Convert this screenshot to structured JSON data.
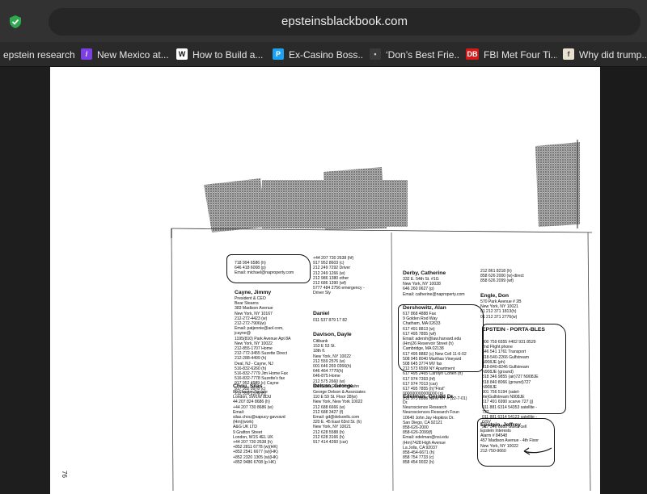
{
  "browser": {
    "url": "epsteinsblackbook.com",
    "bookmarks": [
      {
        "label": "epstein research",
        "icon": "folder-icon",
        "color": "#2a2a2a"
      },
      {
        "label": "New Mexico at...",
        "icon": "bookmark-icon",
        "color": "#7b3fe4"
      },
      {
        "label": "How to Build a...",
        "icon": "bookmark-icon",
        "color": "#111111"
      },
      {
        "label": "Ex-Casino Boss...",
        "icon": "bookmark-icon",
        "color": "#1da1f2"
      },
      {
        "label": "‘Don’s Best Frie...",
        "icon": "bookmark-icon",
        "color": "#333333"
      },
      {
        "label": "FBI Met Four Ti...",
        "icon": "bookmark-icon",
        "color": "#d11a1a"
      },
      {
        "label": "Why did trump...",
        "icon": "bookmark-icon",
        "color": "#e8e1cf"
      }
    ]
  },
  "document": {
    "page_number": "76",
    "entries": [
      {
        "name": "",
        "lines": "718 994 6586 (h)\n646 418 6008 (p)\nEmail: michael@naproperty.com"
      },
      {
        "name": "Cayne, Jimmy",
        "lines": "President & CEO\nBear Stearns\n383 Madison Avenue\nNew York, NY 10167\n212-272-4423 (w)\n212-272-7906(w)\nEmail: patjennie@aol.com,\njcayne@\n1195(810) Park Avenue Apt 8A\nNew York, NY 10022\n212-855-1707 Home\n212-772-3455 Suzette Direct\n212-288-4499 (h)\nDeal, NJ - Cayne, NJ\n516-832-6260 (h)\n516-832-7779 Jim Home Fax\n516-832-7778 Suzette's fax\n917 952 4989 (c) Cayne\n917 952 0978 (c)\n212 559 2576 (h)"
      },
      {
        "name": "Chou, Silas",
        "lines": "80 Chester Square\nLondon, SW1W 8DU\n44 207 824 8686 (h)\n+44 207 730 8686 (w)\nEmail:\nsilas.chou@sapucy-gavvavd\n(Hm)(work)\nA&G UK LTD\n9 Grafton Street\nLondon, W1S 4EL UK\n+44 207 730 2638 (h)\n+852 2811 6778 (w)(HK)\n+852 2541 6677 (w)(HK)\n+852 2320 1305 (w)(HK)\n+852 9486 6708 (p HK)"
      },
      {
        "name": "",
        "lines": "+44 207 730 2638 (hf)\n917 952 8603 (c)\n212 249 7292 Driver\n212 249 1266 (w)\n212 986 1380 other\n212 686 1390 (wf)\n5777 484 2756 emergency -\nDriver Sly"
      },
      {
        "name": "Daniel",
        "lines": "011 537 879 17 82"
      },
      {
        "name": "Davison, Dayle",
        "lines": "Citibank\n153 E 53 St.\n18th fl.\nNew York, NY 10022\n212 559 2576 (w)\n001 646 269 0366(h)\n646 464 7770(h)\n646-875 Home\n212 575 2660 (w)\n858 6066 Geoff VonKuhn"
      },
      {
        "name": "Delson, George",
        "lines": "George Delson & Associates\n110 E 59 St. Floor 28(w)\nNew York, New York 10022\n212 688 6666 (w)\n212 688 3427 (f)\nEmail: gd@delsonllc.com\n320 E. 45 East 63rd St. (h)\nNew York, NY 10021\n212 628 5588 (h)\n212 628 3166 (h)\n917 414 4260 (car)"
      },
      {
        "name": "Derby, Catherine",
        "lines": "332 E. 54th St. #1G\nNew York, NY 10028\n646 260 0627 (p)\nEmail: catherine@naproperty.com"
      },
      {
        "name": "Dershowitz, Alan",
        "lines": "617 868 4888 Fax\n9 Golden Rod Way\nChatham, MA 02633\n617 491 8813 (w)\n617 495 7855 (wf)\nEmail: adersh@law.harvard.edu\n(Hm)26 Reservoir Street (h)\nCambridge, MA 02138\n617 495 8882 (c) New Cell 11-6-02\n508 945 8040 Marthas Vineyard\n508 645 3774 MV fax\n212 573 6599 NY Apartment\n617 495 2465 Carolyn Cohen (h)\n617 974 7393 (hf)\n617 974 7013 (car)\n617 495 7855 (h)\"First\"\n000000000000000 (p)\n212 973 8883 NEW NY # (12-7-01)"
      },
      {
        "name": "Edelman, Gerald Dr.",
        "lines": "Dr.\nNeuroscience Research\nNeurosciences Research Foun\n10640 John Jay Hopkins Dr.\nSan Diego, CA 92121\n858-626-2000\n858-626-2099(f)\nEmail: edelman@nsi.edu\n(Hm)7428 High Avenue\nLa Jolla, CA 92037\n858-454-6671 (h)\n858 754 7733 (c)\n858 454 0032 (h)"
      },
      {
        "name": "",
        "lines": "212 861 8218 (h)\n858 626 2000 (w)-direct\n858 626 2099 (wf)"
      },
      {
        "name": "Engle, Don",
        "lines": "570 Park Avenue # 2B\nNew York, NY 10021\n01 212 371 1813(h)\n01 212 371 2776(w)"
      },
      {
        "name": "EPSTEIN - PORTA-BLES",
        "lines": "800 759 6555 #402 931 8529\n2nd Flight phone\n646 541 1761 Transport\n318-540-2266 Gulfstream\nN908JE (ph)\n318-840-8246 Gulfstream\nN908JE (ground)\n318 346 9855 (air)727 N908JE\n318 840 8066 (ground)727\nN908JE\n901 756 5194 (satel-\nlite)Gulfstream N908JE\n617 491 6990 scarve 727 (j)\n011 881 6314 54353 satellite -\n727\n011 881 6314 54123 satellite -\nGSV\n917 546 6300 Guest cell"
      },
      {
        "name": "Epstein, Jeffrey",
        "lines": "Epstein Interests\nAlarm # 84548\n457 Madison Avenue - 4th Floor\nNew York, NY 10022\n212-750-9660"
      }
    ]
  }
}
